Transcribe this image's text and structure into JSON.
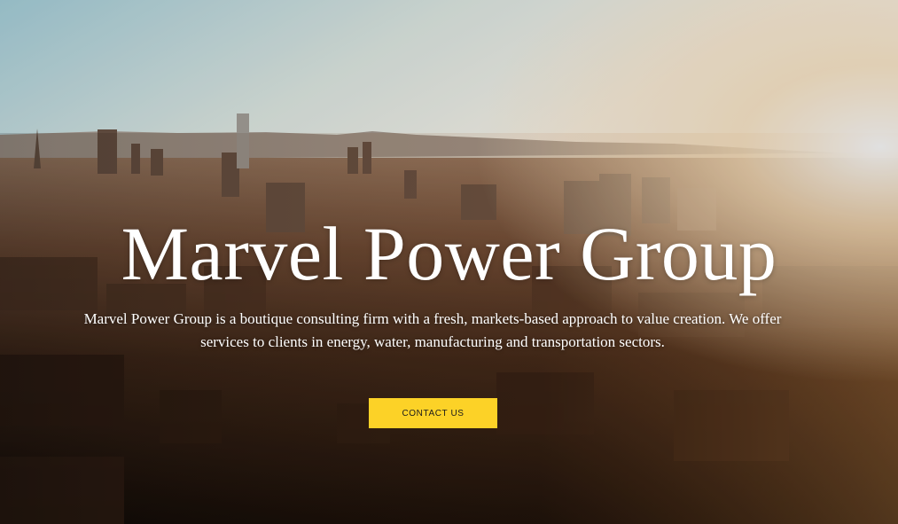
{
  "hero": {
    "title": "Marvel Power Group",
    "description": "Marvel Power Group is a boutique consulting firm with a fresh, markets-based approach to value creation. We offer services to clients in energy, water, manufacturing and transportation sectors.",
    "cta_label": "CONTACT US",
    "background_image": "city-skyline-sunset-photo"
  },
  "colors": {
    "cta_background": "#fcd227",
    "cta_text": "#1b1b1b",
    "title_text": "#ffffff",
    "sky_top": "#b9dbe6",
    "sun_glow": "#fff4df",
    "city_dark": "#1a120c"
  }
}
